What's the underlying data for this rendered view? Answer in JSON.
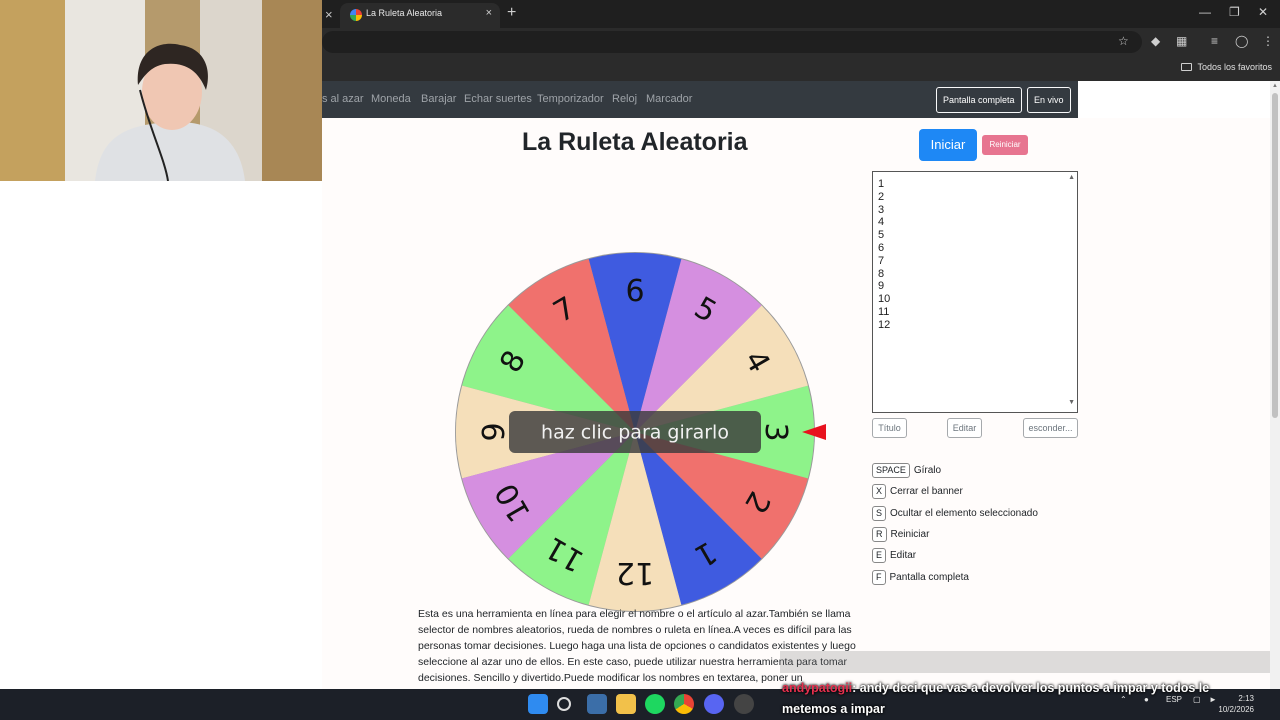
{
  "browser": {
    "tab_title": "La Ruleta Aleatoria",
    "tab_close": "×",
    "prev_tab_close": "×",
    "new_tab": "+",
    "bookmarks_all": "Todos los favoritos"
  },
  "site_nav": {
    "items": [
      "s al azar",
      "Moneda",
      "Barajar",
      "Echar suertes",
      "Temporizador",
      "Reloj",
      "Marcador"
    ],
    "fullscreen_button": "Pantalla completa",
    "live_button": "En vivo"
  },
  "main": {
    "title": "La Ruleta Aleatoria",
    "start_button": "Iniciar",
    "reset_button": "Reiniciar",
    "wheel_banner": "haz clic para girarlo"
  },
  "wheel": {
    "segments": [
      {
        "label": "1",
        "color": "#3f5be0"
      },
      {
        "label": "2",
        "color": "#f0716d"
      },
      {
        "label": "3",
        "color": "#8ef38a"
      },
      {
        "label": "4",
        "color": "#f5dfba"
      },
      {
        "label": "5",
        "color": "#d58fe0"
      },
      {
        "label": "6",
        "color": "#3f5be0"
      },
      {
        "label": "7",
        "color": "#f0716d"
      },
      {
        "label": "8",
        "color": "#8ef38a"
      },
      {
        "label": "9",
        "color": "#f5dfba"
      },
      {
        "label": "10",
        "color": "#d58fe0"
      },
      {
        "label": "11",
        "color": "#8ef38a"
      },
      {
        "label": "12",
        "color": "#f5dfba"
      }
    ],
    "pointer_color": "#e8121e"
  },
  "names_list": [
    "1",
    "2",
    "3",
    "4",
    "5",
    "6",
    "7",
    "8",
    "9",
    "10",
    "11",
    "12"
  ],
  "list_buttons": {
    "title": "Título",
    "edit": "Editar",
    "hide": "esconder..."
  },
  "shortcuts": [
    {
      "key": "SPACE",
      "label": "Gíralo"
    },
    {
      "key": "X",
      "label": "Cerrar el banner"
    },
    {
      "key": "S",
      "label": "Ocultar el elemento seleccionado"
    },
    {
      "key": "R",
      "label": "Reiniciar"
    },
    {
      "key": "E",
      "label": "Editar"
    },
    {
      "key": "F",
      "label": "Pantalla completa"
    }
  ],
  "description": "Esta es una herramienta en línea para elegir el nombre o el artículo al azar.También se llama selector de nombres aleatorios, rueda de nombres o ruleta en línea.A veces es difícil para las personas tomar decisiones. Luego haga una lista de opciones o candidatos existentes y luego seleccione al azar uno de ellos. En este caso, puede utilizar nuestra herramienta para tomar decisiones. Sencillo y divertido.Puede modificar los nombres en textarea, poner un",
  "taskbar": {
    "language": "ESP",
    "time": "2:13",
    "date": "10/2/2026"
  },
  "chat": {
    "username": "andypatogii",
    "message": ": andy deci que vas a devolver los puntos a impar y todos le metemos a impar"
  }
}
